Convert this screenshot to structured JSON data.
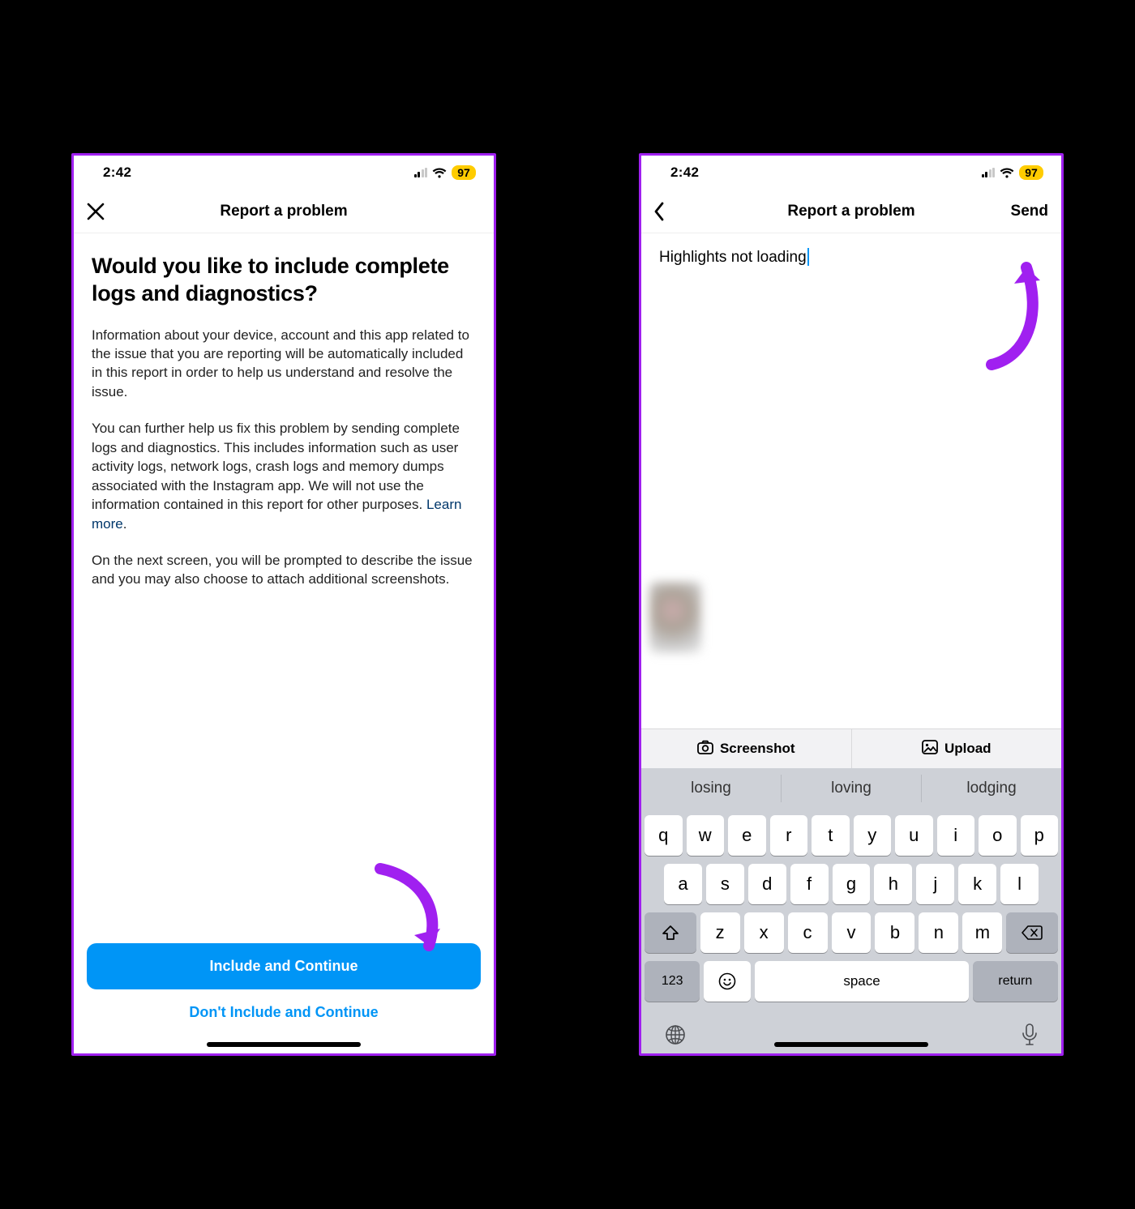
{
  "status": {
    "time": "2:42",
    "battery": "97"
  },
  "left": {
    "header_title": "Report a problem",
    "heading": "Would you like to include complete logs and diagnostics?",
    "p1": "Information about your device, account and this app related to the issue that you are reporting will be automatically included in this report in order to help us understand and resolve the issue.",
    "p2a": "You can further help us fix this problem by sending complete logs and diagnostics. This includes information such as user activity logs, network logs, crash logs and memory dumps associated with the Instagram app. We will not use the information contained in this report for other purposes. ",
    "learn_more": "Learn more",
    "p2b": ".",
    "p3": "On the next screen, you will be prompted to describe the issue and you may also choose to attach additional screenshots.",
    "primary_btn": "Include and Continue",
    "secondary_btn": "Don't Include and Continue"
  },
  "right": {
    "header_title": "Report a problem",
    "send_label": "Send",
    "input_value": "Highlights not loading",
    "action_screenshot": "Screenshot",
    "action_upload": "Upload",
    "suggestions": [
      "losing",
      "loving",
      "lodging"
    ],
    "row1": [
      "q",
      "w",
      "e",
      "r",
      "t",
      "y",
      "u",
      "i",
      "o",
      "p"
    ],
    "row2": [
      "a",
      "s",
      "d",
      "f",
      "g",
      "h",
      "j",
      "k",
      "l"
    ],
    "row3": [
      "z",
      "x",
      "c",
      "v",
      "b",
      "n",
      "m"
    ],
    "key_123": "123",
    "key_space": "space",
    "key_return": "return"
  }
}
